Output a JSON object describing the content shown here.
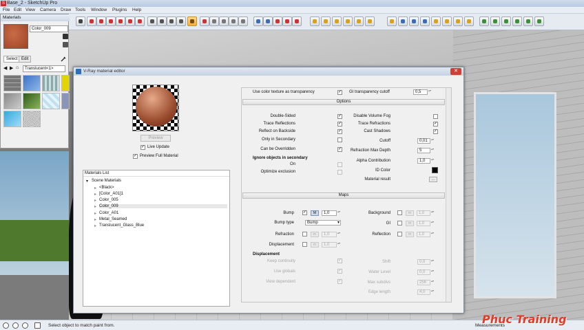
{
  "app": {
    "title": "Base_2 - SketchUp Pro"
  },
  "menu": [
    "File",
    "Edit",
    "View",
    "Camera",
    "Draw",
    "Tools",
    "Window",
    "Plugins",
    "Help"
  ],
  "materials_panel": {
    "title": "Materials",
    "current_material": "Color_009",
    "tabs": [
      "Select",
      "Edit"
    ],
    "collection": "Translucent<1>"
  },
  "vray": {
    "title": "V-Ray material editor",
    "preview_button": "Preview",
    "live_update": "Live Update",
    "preview_full": "Preview Full Material",
    "materials_list": {
      "header": "Materials List",
      "root": "Scene Materials",
      "items": [
        "<Black>",
        "[Color_A01]1",
        "Color_005",
        "Color_009",
        "Color_A01",
        "Metal_Seamed",
        "Translucent_Glass_Blue"
      ],
      "selected_index": 3
    },
    "top_row": {
      "use_color_texture": "Use color texture as transparency",
      "gi_transparency_cutoff": "GI transparency cutoff",
      "gi_value": "0,5"
    },
    "options": {
      "header": "Options",
      "left": [
        {
          "label": "Double-Sided",
          "checked": "✓"
        },
        {
          "label": "Trace Reflections",
          "checked": "✓"
        },
        {
          "label": "Reflect on Backside",
          "checked": "✓"
        },
        {
          "label": "Only in Secondary",
          "checked": ""
        },
        {
          "label": "Can be Overridden",
          "checked": "✓"
        }
      ],
      "ignore_secondary": "Ignore objects in secondary",
      "on_label": "On",
      "optimize_exclusion": "Optimize exclusion",
      "right": {
        "disable_volume_fog": "Disable Volume Fog",
        "trace_refractions": "Trace Refractions",
        "cast_shadows": "Cast Shadows",
        "cutoff": "Cutoff",
        "cutoff_value": "0,01",
        "refraction_max_depth": "Refraction Max Depth",
        "refraction_max_depth_value": "5",
        "alpha_contribution": "Alpha Contribution",
        "alpha_contribution_value": "1,0",
        "id_color": "ID Color",
        "material_result": "Material result",
        "material_result_button": "..."
      }
    },
    "maps": {
      "header": "Maps",
      "bump": "Bump",
      "bump_value": "1,0",
      "map_button": "m",
      "bump_map_button": "M",
      "bump_type": "Bump type",
      "bump_type_value": "Bump",
      "refraction": "Refraction",
      "refraction_value": "1,0",
      "displacement": "Displacement",
      "displacement_value": "1,0",
      "background": "Background",
      "background_value": "1,0",
      "gi": "GI",
      "gi_value": "1,0",
      "reflection": "Reflection",
      "reflection_value": "1,0"
    },
    "displacement": {
      "header": "Displacement",
      "keep_continuity": "Keep continuity",
      "use_globals": "Use globals",
      "view_dependent": "View dependent",
      "shift": "Shift",
      "shift_value": "0,0",
      "water_level": "Water Level",
      "water_level_value": "0,0",
      "max_subdivs": "Max subdivs",
      "max_subdivs_value": "256",
      "edge_length": "Edge length",
      "edge_length_value": "4,0"
    }
  },
  "status": {
    "text": "Select object to match paint from.",
    "measurements": "Measurements"
  },
  "watermark": "Phuc Training"
}
